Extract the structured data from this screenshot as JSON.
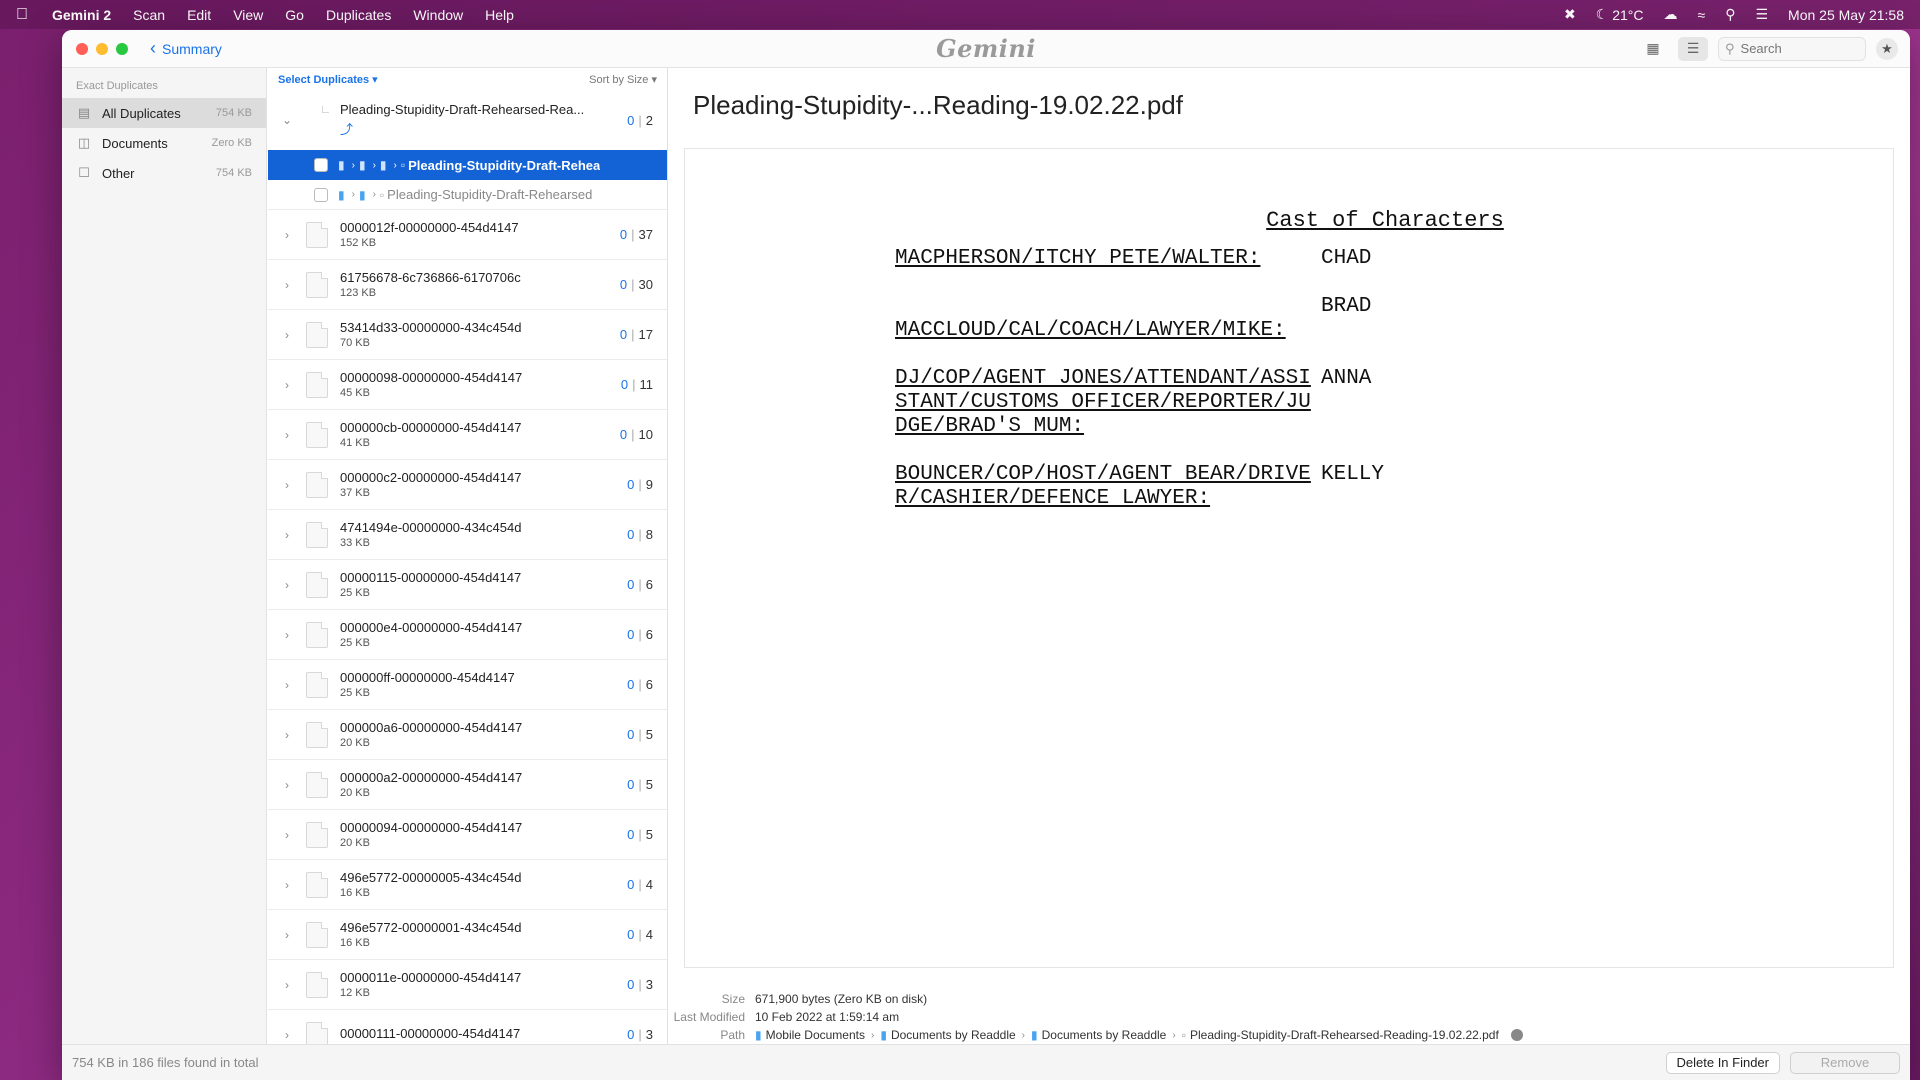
{
  "menubar": {
    "app_name": "Gemini 2",
    "items": [
      "Scan",
      "Edit",
      "View",
      "Go",
      "Duplicates",
      "Window",
      "Help"
    ],
    "temperature": "21°C",
    "datetime": "Mon 25 May  21:58"
  },
  "titlebar": {
    "back_label": "Summary",
    "logo": "Gemini",
    "search_placeholder": "Search"
  },
  "sidebar": {
    "section_title": "Exact Duplicates",
    "items": [
      {
        "label": "All Duplicates",
        "size": "754 KB"
      },
      {
        "label": "Documents",
        "size": "Zero KB"
      },
      {
        "label": "Other",
        "size": "754 KB"
      }
    ]
  },
  "list": {
    "select_label": "Select Duplicates ▾",
    "sort_label": "Sort by Size ▾",
    "expanded": {
      "name": "Pleading-Stupidity-Draft-Rehearsed-Rea...",
      "selected": "0",
      "count": "2",
      "children": [
        {
          "name": "Pleading-Stupidity-Draft-Rehea"
        },
        {
          "name": "Pleading-Stupidity-Draft-Rehearsed"
        }
      ]
    },
    "groups": [
      {
        "name": "0000012f-00000000-454d4147",
        "size": "152 KB",
        "selected": "0",
        "count": "37"
      },
      {
        "name": "61756678-6c736866-6170706c",
        "size": "123 KB",
        "selected": "0",
        "count": "30"
      },
      {
        "name": "53414d33-00000000-434c454d",
        "size": "70 KB",
        "selected": "0",
        "count": "17"
      },
      {
        "name": "00000098-00000000-454d4147",
        "size": "45 KB",
        "selected": "0",
        "count": "11"
      },
      {
        "name": "000000cb-00000000-454d4147",
        "size": "41 KB",
        "selected": "0",
        "count": "10"
      },
      {
        "name": "000000c2-00000000-454d4147",
        "size": "37 KB",
        "selected": "0",
        "count": "9"
      },
      {
        "name": "4741494e-00000000-434c454d",
        "size": "33 KB",
        "selected": "0",
        "count": "8"
      },
      {
        "name": "00000115-00000000-454d4147",
        "size": "25 KB",
        "selected": "0",
        "count": "6"
      },
      {
        "name": "000000e4-00000000-454d4147",
        "size": "25 KB",
        "selected": "0",
        "count": "6"
      },
      {
        "name": "000000ff-00000000-454d4147",
        "size": "25 KB",
        "selected": "0",
        "count": "6"
      },
      {
        "name": "000000a6-00000000-454d4147",
        "size": "20 KB",
        "selected": "0",
        "count": "5"
      },
      {
        "name": "000000a2-00000000-454d4147",
        "size": "20 KB",
        "selected": "0",
        "count": "5"
      },
      {
        "name": "00000094-00000000-454d4147",
        "size": "20 KB",
        "selected": "0",
        "count": "5"
      },
      {
        "name": "496e5772-00000005-434c454d",
        "size": "16 KB",
        "selected": "0",
        "count": "4"
      },
      {
        "name": "496e5772-00000001-434c454d",
        "size": "16 KB",
        "selected": "0",
        "count": "4"
      },
      {
        "name": "0000011e-00000000-454d4147",
        "size": "12 KB",
        "selected": "0",
        "count": "3"
      },
      {
        "name": "00000111-00000000-454d4147",
        "size": "",
        "selected": "0",
        "count": "3"
      }
    ]
  },
  "preview": {
    "title": "Pleading-Stupidity-...Reading-19.02.22.pdf",
    "document": {
      "heading": "Cast of Characters",
      "cast": [
        {
          "role": "MACPHERSON/ITCHY PETE/WALTER:",
          "actor": "CHAD"
        },
        {
          "role": "MACCLOUD/CAL/COACH/LAWYER/MIKE:",
          "actor": "BRAD"
        },
        {
          "role": "DJ/COP/AGENT JONES/ATTENDANT/ASSISTANT/CUSTOMS OFFICER/REPORTER/JUDGE/BRAD'S MUM:",
          "actor": "ANNA"
        },
        {
          "role": "BOUNCER/COP/HOST/AGENT BEAR/DRIVER/CASHIER/DEFENCE LAWYER:",
          "actor": "KELLY"
        }
      ]
    },
    "meta": {
      "size_label": "Size",
      "size_value": "671,900 bytes (Zero KB on disk)",
      "modified_label": "Last Modified",
      "modified_value": "10 Feb 2022 at 1:59:14 am",
      "path_label": "Path",
      "path": [
        "Mobile Documents",
        "Documents by Readdle",
        "Documents by Readdle",
        "Pleading-Stupidity-Draft-Rehearsed-Reading-19.02.22.pdf"
      ]
    }
  },
  "statusbar": {
    "summary": "754 KB in 186 files found in total",
    "delete_label": "Delete In Finder",
    "remove_label": "Remove"
  }
}
